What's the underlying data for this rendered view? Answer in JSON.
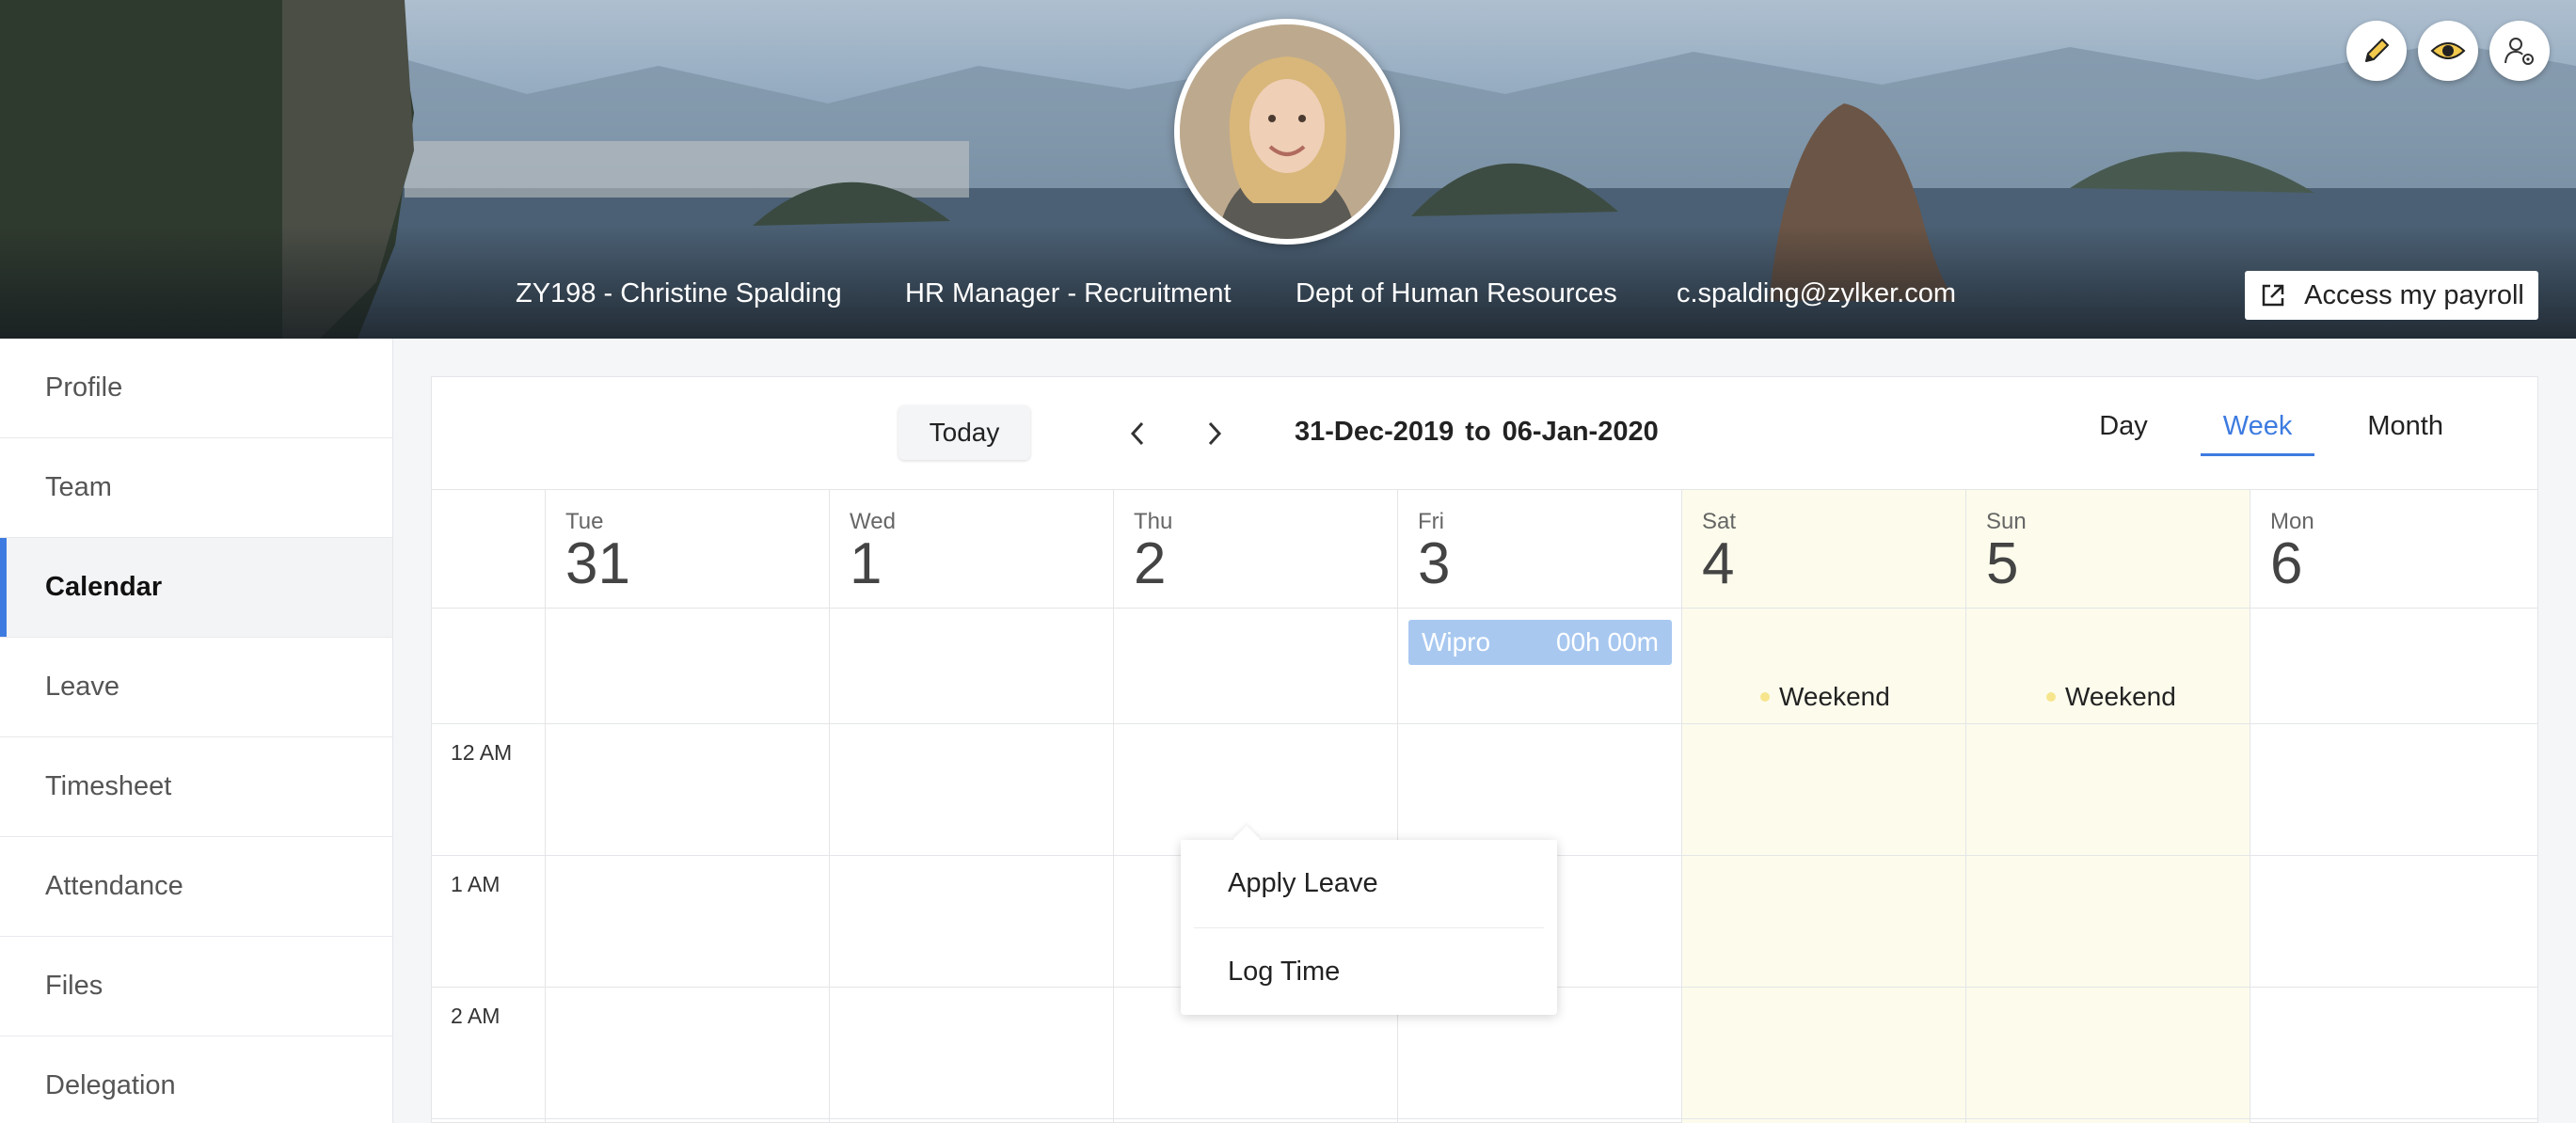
{
  "banner": {
    "employee_label": "ZY198 - Christine Spalding",
    "designation": "HR Manager - Recruitment",
    "department": "Dept of Human Resources",
    "email": "c.spalding@zylker.com",
    "payroll_button": "Access my payroll",
    "actions": [
      "pencil-icon",
      "eye-icon",
      "user-settings-icon"
    ]
  },
  "sidebar": {
    "items": [
      {
        "label": "Profile"
      },
      {
        "label": "Team"
      },
      {
        "label": "Calendar",
        "active": true
      },
      {
        "label": "Leave"
      },
      {
        "label": "Timesheet"
      },
      {
        "label": "Attendance"
      },
      {
        "label": "Files"
      },
      {
        "label": "Delegation"
      }
    ]
  },
  "calendar": {
    "today_label": "Today",
    "range_start": "31-Dec-2019",
    "range_to": "to",
    "range_end": "06-Jan-2020",
    "views": [
      "Day",
      "Week",
      "Month"
    ],
    "active_view": "Week",
    "days": [
      {
        "name": "Tue",
        "num": "31"
      },
      {
        "name": "Wed",
        "num": "1"
      },
      {
        "name": "Thu",
        "num": "2"
      },
      {
        "name": "Fri",
        "num": "3"
      },
      {
        "name": "Sat",
        "num": "4",
        "weekend": true
      },
      {
        "name": "Sun",
        "num": "5",
        "weekend": true
      },
      {
        "name": "Mon",
        "num": "6"
      }
    ],
    "times": [
      "12 AM",
      "1 AM",
      "2 AM"
    ],
    "event": {
      "title": "Wipro",
      "duration": "00h 00m"
    },
    "weekend_label": "Weekend",
    "colors": {
      "accent": "#3d7be0",
      "event": "#a8c8f0",
      "weekend_bg": "#fdfcec"
    }
  },
  "popup": {
    "items": [
      "Apply Leave",
      "Log Time"
    ]
  }
}
